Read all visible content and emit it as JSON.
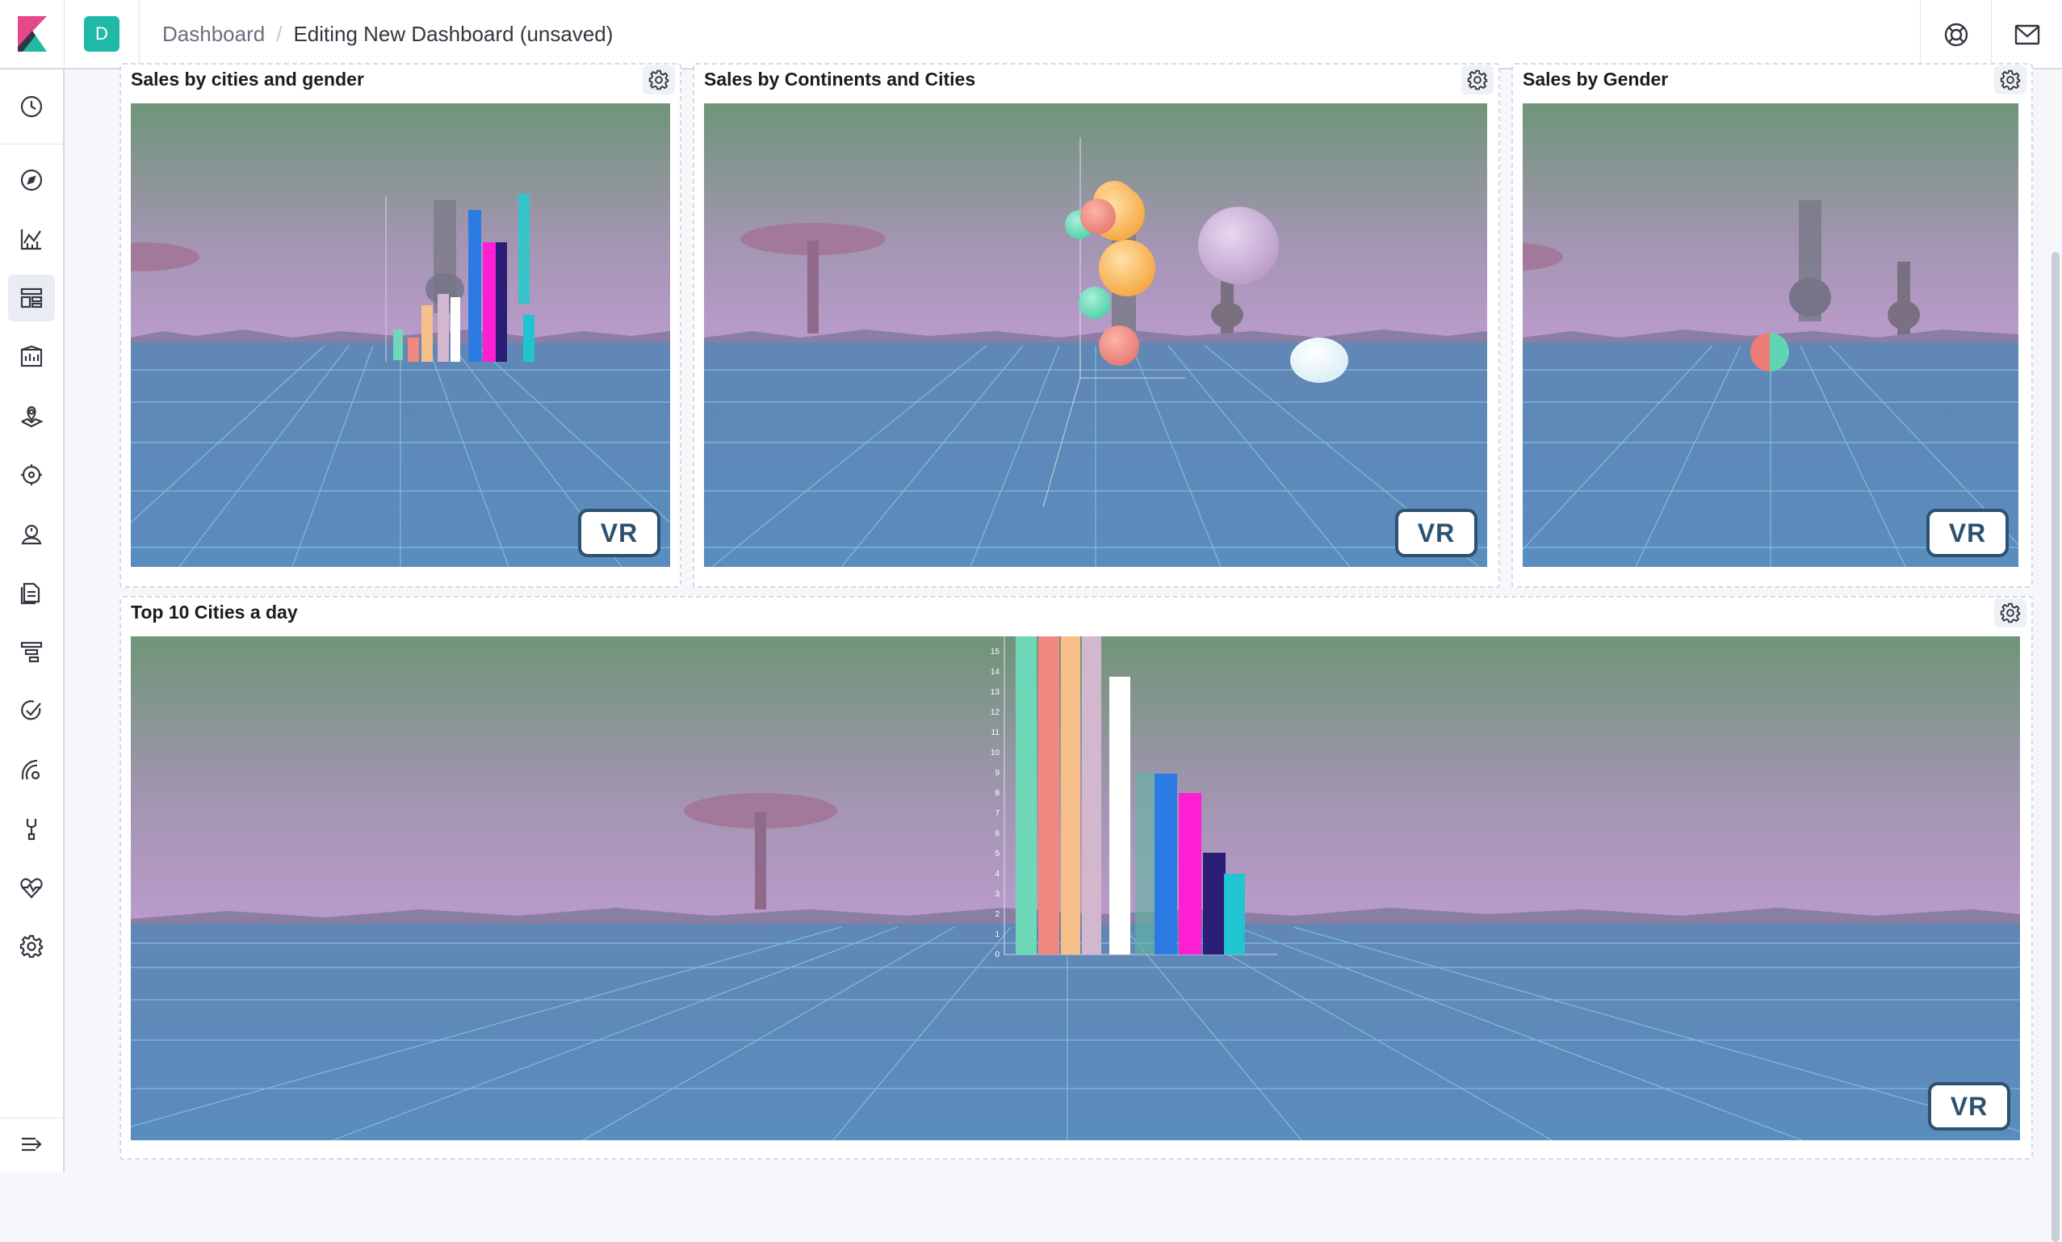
{
  "header": {
    "space_initial": "D",
    "breadcrumbs": [
      "Dashboard",
      "Editing New Dashboard (unsaved)"
    ],
    "help_icon": "lifebuoy-icon",
    "mail_icon": "mail-icon"
  },
  "sidenav": {
    "items": [
      {
        "id": "recent",
        "icon": "clock-icon"
      },
      {
        "id": "discover",
        "icon": "compass-icon"
      },
      {
        "id": "visualize",
        "icon": "chart-icon"
      },
      {
        "id": "dashboard",
        "icon": "dashboard-icon",
        "active": true
      },
      {
        "id": "canvas",
        "icon": "canvas-icon"
      },
      {
        "id": "maps",
        "icon": "map-pin-icon"
      },
      {
        "id": "ml",
        "icon": "machine-learning-icon"
      },
      {
        "id": "infrastructure",
        "icon": "infrastructure-icon"
      },
      {
        "id": "logs",
        "icon": "logs-icon"
      },
      {
        "id": "apm",
        "icon": "apm-icon"
      },
      {
        "id": "uptime",
        "icon": "uptime-icon"
      },
      {
        "id": "siem",
        "icon": "siem-icon"
      },
      {
        "id": "devtools",
        "icon": "wrench-icon"
      },
      {
        "id": "monitoring",
        "icon": "heartbeat-icon"
      },
      {
        "id": "management",
        "icon": "gear-icon"
      }
    ],
    "collapse_icon": "menu-collapse-icon"
  },
  "panels": [
    {
      "id": "sales-cities-gender",
      "title": "Sales by cities and gender",
      "vr_label": "VR"
    },
    {
      "id": "sales-continents-cities",
      "title": "Sales by Continents and Cities",
      "vr_label": "VR"
    },
    {
      "id": "sales-gender",
      "title": "Sales by Gender",
      "vr_label": "VR"
    },
    {
      "id": "top10-cities",
      "title": "Top 10 Cities a day",
      "vr_label": "VR"
    }
  ],
  "top10_axis_ticks": [
    "0",
    "1",
    "2",
    "3",
    "4",
    "5",
    "6",
    "7",
    "8",
    "9",
    "10",
    "11",
    "12",
    "13",
    "14",
    "15"
  ],
  "colors": {
    "sky_top": "#6f9578",
    "sky_bottom": "#b495c6",
    "ground": "#5a88ba",
    "grid": "#8fd3e8",
    "vr_border": "#2c5270",
    "accent_teal": "#20b9a5"
  }
}
